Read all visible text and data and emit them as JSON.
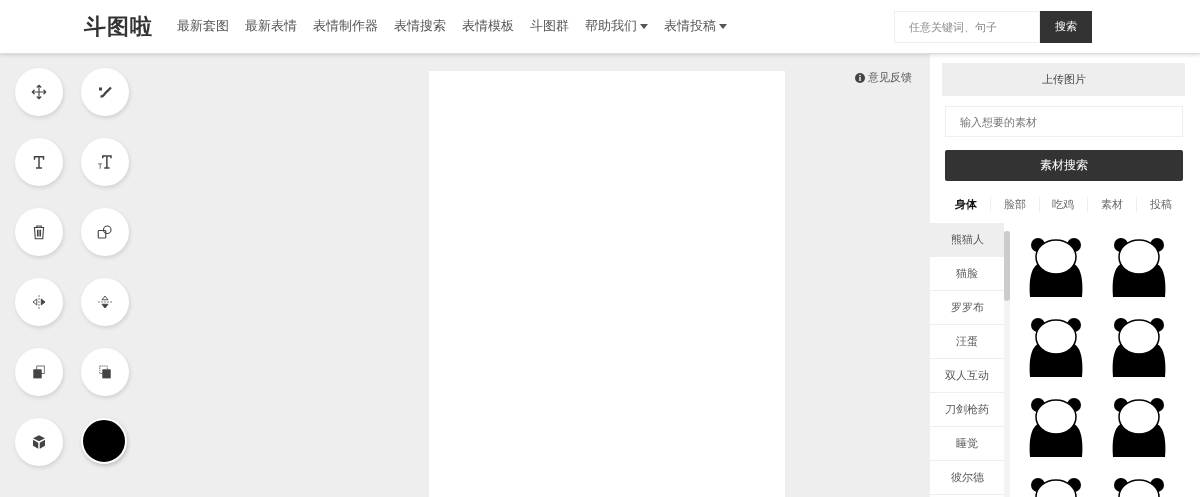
{
  "header": {
    "logo": "斗图啦",
    "nav": [
      {
        "label": "最新套图",
        "dropdown": false
      },
      {
        "label": "最新表情",
        "dropdown": false
      },
      {
        "label": "表情制作器",
        "dropdown": false
      },
      {
        "label": "表情搜索",
        "dropdown": false
      },
      {
        "label": "表情模板",
        "dropdown": false
      },
      {
        "label": "斗图群",
        "dropdown": false
      },
      {
        "label": "帮助我们",
        "dropdown": true
      },
      {
        "label": "表情投稿",
        "dropdown": true
      }
    ],
    "search": {
      "placeholder": "任意关键词、句子",
      "button": "搜索"
    }
  },
  "tools": [
    {
      "kind": "move"
    },
    {
      "kind": "brush"
    },
    {
      "kind": "text"
    },
    {
      "kind": "text-small"
    },
    {
      "kind": "delete"
    },
    {
      "kind": "shapes"
    },
    {
      "kind": "flip-h"
    },
    {
      "kind": "flip-v"
    },
    {
      "kind": "front"
    },
    {
      "kind": "back"
    },
    {
      "kind": "cube"
    },
    {
      "kind": "color",
      "color": "#000000"
    }
  ],
  "feedback": "意见反馈",
  "panel": {
    "upload": "上传图片",
    "search_placeholder": "输入想要的素材",
    "search_button": "素材搜索",
    "tabs": [
      {
        "label": "身体",
        "selected": true
      },
      {
        "label": "脸部",
        "selected": false
      },
      {
        "label": "吃鸡",
        "selected": false
      },
      {
        "label": "素材",
        "selected": false
      },
      {
        "label": "投稿",
        "selected": false
      }
    ],
    "categories": [
      {
        "label": "熊猫人",
        "selected": true
      },
      {
        "label": "猫脸",
        "selected": false
      },
      {
        "label": "罗罗布",
        "selected": false
      },
      {
        "label": "汪蛋",
        "selected": false
      },
      {
        "label": "双人互动",
        "selected": false
      },
      {
        "label": "刀剑枪药",
        "selected": false
      },
      {
        "label": "睡觉",
        "selected": false
      },
      {
        "label": "彼尔德",
        "selected": false
      }
    ]
  }
}
